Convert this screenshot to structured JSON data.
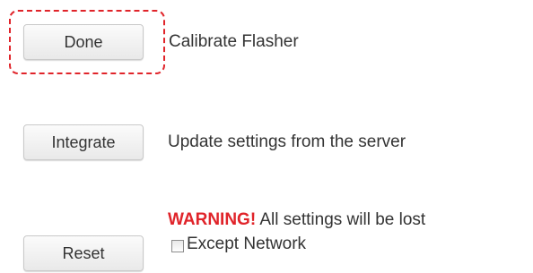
{
  "actions": [
    {
      "button_label": "Done",
      "description": "Calibrate Flasher"
    },
    {
      "button_label": "Integrate",
      "description": "Update settings from the server"
    },
    {
      "button_label": "Reset",
      "warning_label": "WARNING!",
      "warning_text": " All settings will be lost",
      "checkbox_label": "Except Network",
      "checkbox_checked": false
    }
  ],
  "colors": {
    "warning": "#e0242a",
    "focus_ring": "#e0242a"
  },
  "icons": {
    "checkbox": "checkbox-unchecked"
  }
}
